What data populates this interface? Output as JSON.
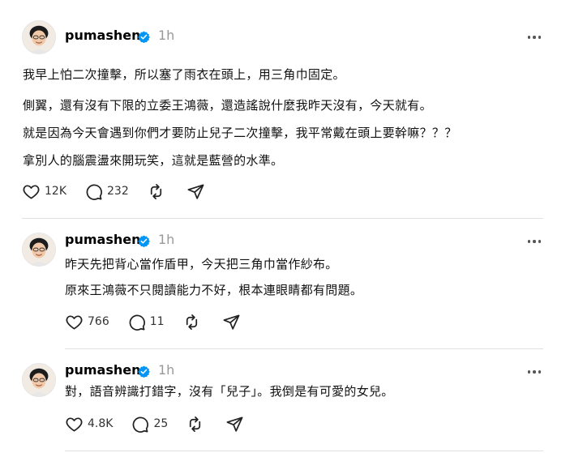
{
  "posts": [
    {
      "username": "pumashen",
      "time": "1h",
      "lines": [
        "我早上怕二次撞擊，所以塞了雨衣在頭上，用三角巾固定。",
        "側翼，還有沒有下限的立委王鴻薇，還造謠說什麼我昨天沒有，今天就有。",
        "就是因為今天會遇到你們才要防止兒子二次撞擊，我平常戴在頭上要幹嘛？？？",
        "拿別人的腦震盪來開玩笑，這就是藍營的水準。"
      ],
      "likes": "12K",
      "replies": "232"
    },
    {
      "username": "pumashen",
      "time": "1h",
      "lines": [
        "昨天先把背心當作盾甲，今天把三角巾當作紗布。",
        "原來王鴻薇不只閱讀能力不好，根本連眼睛都有問題。"
      ],
      "likes": "766",
      "replies": "11"
    },
    {
      "username": "pumashen",
      "time": "1h",
      "lines": [
        "對，語音辨識打錯字，沒有「兒子」。我倒是有可愛的女兒。"
      ],
      "likes": "4.8K",
      "replies": "25"
    }
  ],
  "icons": {
    "like": "heart-icon",
    "reply": "comment-bubble-icon",
    "repost": "repost-icon",
    "share": "send-icon",
    "verified": "verified-badge-icon",
    "more": "more-options-icon"
  },
  "colors": {
    "verified": "#0095f6",
    "muted": "#999999",
    "divider": "#e0e0e0"
  }
}
